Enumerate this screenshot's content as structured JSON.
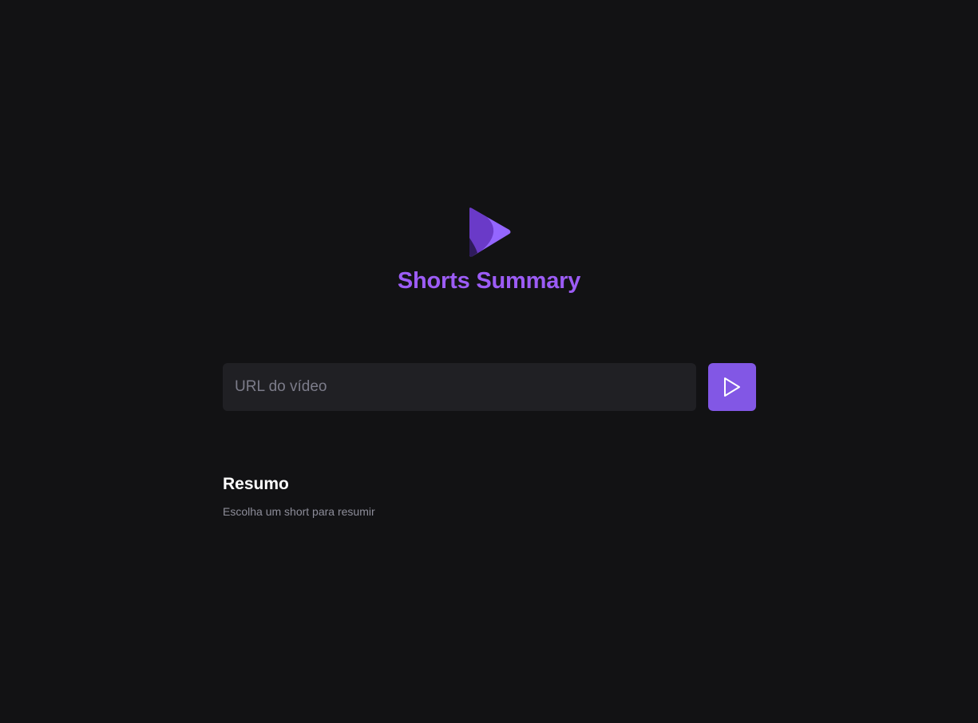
{
  "app": {
    "title": "Shorts Summary",
    "logo_icon": "play-logo-icon"
  },
  "form": {
    "url_placeholder": "URL do vídeo",
    "url_value": "",
    "submit_icon": "play-icon"
  },
  "summary": {
    "heading": "Resumo",
    "text": "Escolha um short para resumir"
  },
  "colors": {
    "background": "#121214",
    "accent": "#8257e5",
    "title": "#9c5cf5",
    "input_bg": "#202024",
    "muted_text": "#8d8d99"
  }
}
